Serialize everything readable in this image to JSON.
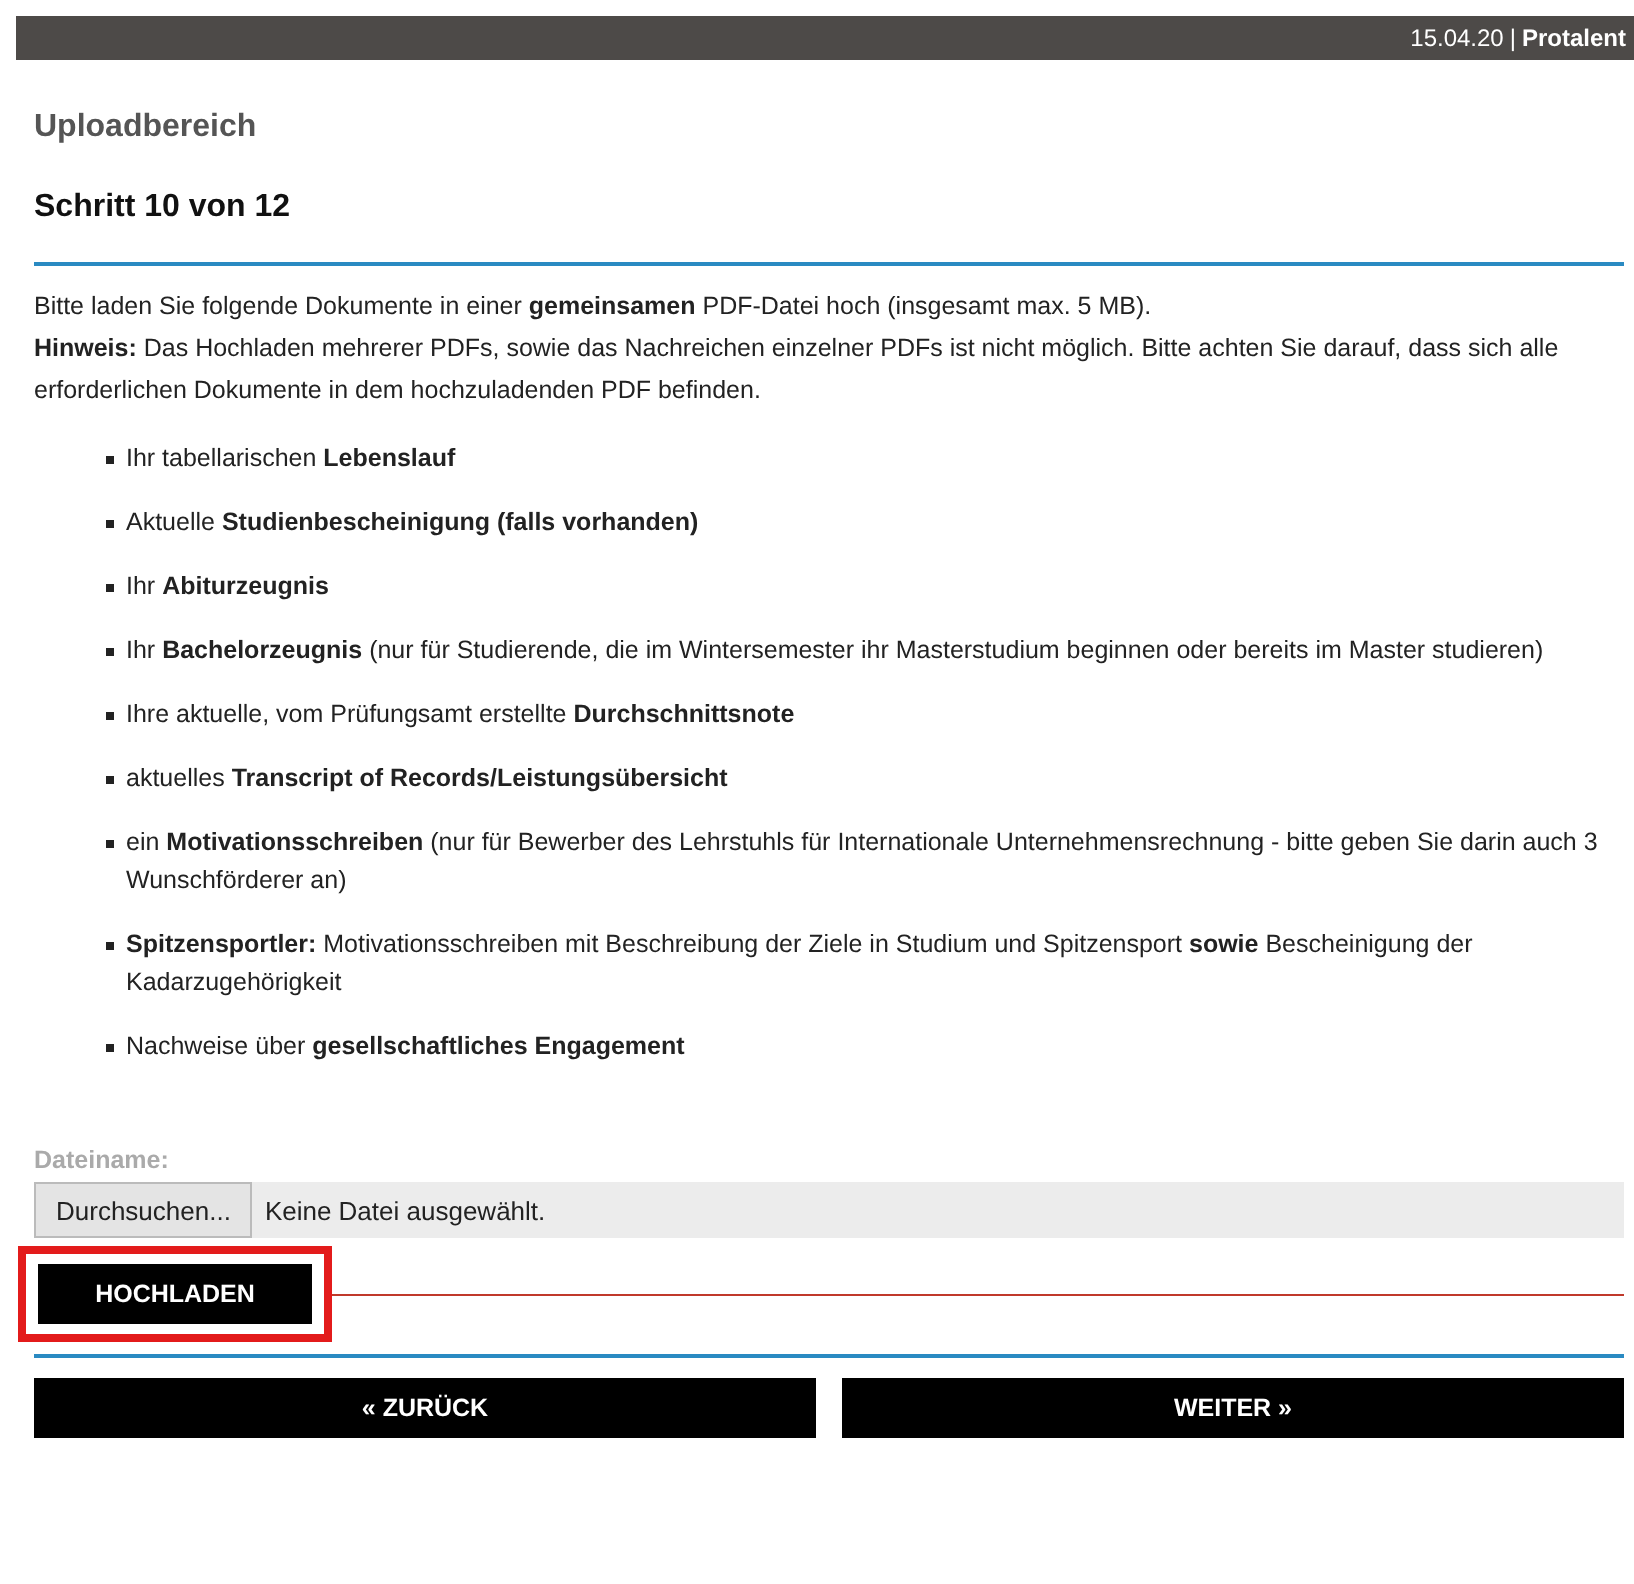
{
  "top_bar": {
    "date": "15.04.20",
    "separator": "|",
    "brand": "Protalent"
  },
  "section_title": "Uploadbereich",
  "step": "Schritt 10 von 12",
  "intro": [
    "Bitte laden Sie folgende Dokumente in einer **gemeinsamen** PDF-Datei hoch (insgesamt max. 5 MB).",
    "**Hinweis:** Das Hochladen mehrerer PDFs, sowie das Nachreichen einzelner PDFs ist nicht möglich. Bitte achten Sie darauf, dass sich alle erforderlichen Dokumente in dem hochzuladenden PDF befinden."
  ],
  "documents": [
    {
      "text": "Ihr tabellarischen **Lebenslauf**"
    },
    {
      "text": "Aktuelle **Studienbescheinigung (falls vorhanden)**"
    },
    {
      "text": "Ihr **Abiturzeugnis**"
    },
    {
      "text": "Ihr **Bachelorzeugnis** (nur für Studierende, die im Wintersemester ihr Masterstudium beginnen oder bereits im Master studieren)"
    },
    {
      "text": "Ihre aktuelle, vom Prüfungsamt erstellte **Durchschnittsnote**"
    },
    {
      "text": "aktuelles **Transcript of Records/Leistungsübersicht**"
    },
    {
      "text": "ein **Motivationsschreiben** (nur für Bewerber des Lehrstuhls für Internationale Unternehmensrechnung - bitte geben Sie darin auch 3 Wunschförderer an)"
    },
    {
      "text": "**Spitzensportler:** Motivationsschreiben mit Beschreibung der Ziele in Studium und Spitzensport **sowie** Bescheinigung der Kadarzugehörigkeit"
    },
    {
      "text": "Nachweise über **gesellschaftliches Engagement**"
    }
  ],
  "file_field": {
    "label": "Dateiname:",
    "browse_button": "Durchsuchen...",
    "status": "Keine Datei ausgewählt."
  },
  "upload_button": {
    "label": "HOCHLADEN",
    "highlighted": true
  },
  "nav": {
    "back": "« ZURÜCK",
    "next": "WEITER »"
  }
}
